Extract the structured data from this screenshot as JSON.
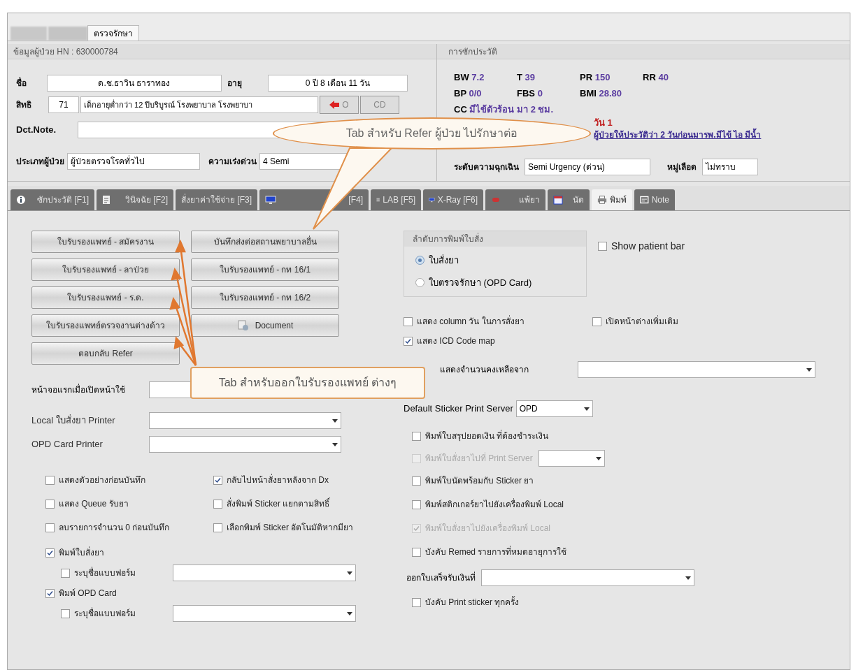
{
  "top_tabs": [
    {
      "label": "ตรวจรักษา",
      "selected": true
    }
  ],
  "patient": {
    "title": "ข้อมูลผู้ป่วย HN : 630000784",
    "name_label": "ชื่อ",
    "name": "ด.ช.ธาวิน ธาราทอง",
    "age_label": "อายุ",
    "age": "0 ปี 8 เดือน 11 วัน",
    "right_label": "สิทธิ",
    "right_code": "71",
    "right_name": "เด็กอายุต่ำกว่า 12 ปีบริบูรณ์ โรงพยาบาล โรงพยาบา",
    "o_button": "O",
    "cd_button": "CD",
    "note_label": "Dct.Note.",
    "type_label": "ประเภทผู้ป่วย",
    "type": "ผู้ป่วยตรวจโรคทั่วไป",
    "urgency_label": "ความเร่งด่วน",
    "urgency": "4 Semi"
  },
  "history": {
    "title": "การซักประวัติ",
    "vitals": [
      [
        {
          "label": "BW",
          "value": "7.2"
        },
        {
          "label": "T",
          "value": "39"
        },
        {
          "label": "PR",
          "value": "150"
        },
        {
          "label": "RR",
          "value": "40"
        }
      ],
      [
        {
          "label": "BP",
          "value": "0/0"
        },
        {
          "label": "FBS",
          "value": "0"
        },
        {
          "label": "BMI",
          "value": "28.80"
        }
      ]
    ],
    "cc_label": "CC",
    "cc": "มีไข้ตัวร้อน มา 2 ชม.",
    "cc_extra": "วัน 1",
    "hpi": "ผู้ป่วยให้ประวัติว่า 2 วันก่อนมารพ.มีไข้ ไอ มีน้ำ",
    "emergency_label": "ระดับความฉุกเฉิน",
    "emergency": "Semi Urgency (ด่วน)",
    "blood_label": "หมู่เลือด",
    "blood": "ไม่ทราบ"
  },
  "tabs": [
    {
      "label": "ซักประวัติ [F1]",
      "selected": false
    },
    {
      "label": "วินิจฉัย [F2]",
      "selected": false
    },
    {
      "label": "สั่งยาค่าใช้จ่าย [F3]",
      "selected": false
    },
    {
      "label": "[F4]",
      "selected": false
    },
    {
      "label": "LAB [F5]",
      "selected": false
    },
    {
      "label": "X-Ray [F6]",
      "selected": false
    },
    {
      "label": "แพ้ยา",
      "selected": false
    },
    {
      "label": "นัด",
      "selected": false
    },
    {
      "label": "พิมพ์",
      "selected": true
    },
    {
      "label": "Note",
      "selected": false
    }
  ],
  "buttons": [
    {
      "kind": "text",
      "label": "ใบรับรองแพทย์ - สมัครงาน"
    },
    {
      "kind": "text",
      "label": "บันทึกส่งต่อสถานพยาบาลอื่น"
    },
    {
      "kind": "text",
      "label": "ใบรับรองแพทย์ - ลาป่วย"
    },
    {
      "kind": "text",
      "label": "ใบรับรองแพทย์ - กท 16/1"
    },
    {
      "kind": "text",
      "label": "ใบรับรองแพทย์ - ร.ด."
    },
    {
      "kind": "text",
      "label": "ใบรับรองแพทย์ - กท 16/2"
    },
    {
      "kind": "text",
      "label": "ใบรับรองแพทย์ตรวจงานต่างด้าว"
    },
    {
      "kind": "icon",
      "label": "Document"
    },
    {
      "kind": "text",
      "label": "ตอบกลับ Refer"
    }
  ],
  "first_screen": {
    "label": "หน้าจอแรกเมื่อเปิดหน้าใช้"
  },
  "printers": [
    {
      "label": "Local ใบสั่งยา Printer"
    },
    {
      "label": "OPD Card Printer"
    }
  ],
  "left_checks": [
    {
      "label": "แสดงตัวอย่างก่อนบันทึก",
      "checked": false
    },
    {
      "label": "กลับไปหน้าสั่งยาหลังจาก Dx",
      "checked": true
    },
    {
      "label": "แสดง Queue รับยา",
      "checked": false
    },
    {
      "label": "สั่งพิมพ์ Sticker แยกตามสิทธิ์",
      "checked": false
    },
    {
      "label": "ลบรายการจำนวน 0 ก่อนบันทึก",
      "checked": false
    },
    {
      "label": "เลือกพิมพ์ Sticker อัตโนมัติหากมียา",
      "checked": false
    }
  ],
  "print_options": [
    {
      "label": "พิมพ์ใบสั่งยา",
      "checked": true,
      "form": {
        "label": "ระบุชื่อแบบฟอร์ม",
        "checked": false
      }
    },
    {
      "label": "พิมพ์ OPD Card",
      "checked": true,
      "form": {
        "label": "ระบุชื่อแบบฟอร์ม",
        "checked": false
      }
    }
  ],
  "print_order": {
    "title": "ลำดับการพิมพ์ใบสั่ง",
    "options": [
      {
        "label": "ใบสั่งยา",
        "selected": true
      },
      {
        "label": "ใบตรวจรักษา (OPD Card)",
        "selected": false
      }
    ]
  },
  "show_patient_bar": {
    "label": "Show patient bar",
    "checked": false
  },
  "display_checks": [
    {
      "label": "แสดง column วัน ในการสั่งยา",
      "checked": false
    },
    {
      "label": "เปิดหน้าต่างเพิ่มเติม",
      "checked": false
    },
    {
      "label": "แสดง ICD Code map",
      "checked": true
    }
  ],
  "stock_from": {
    "label": "แสดงจำนวนคงเหลือจาก"
  },
  "sticker_server": {
    "label": "Default Sticker Print Server",
    "value": "OPD"
  },
  "right_checks": [
    {
      "kind": "check",
      "label": "พิมพ์ใบสรุปยอดเงิน ที่ต้องชำระเงิน",
      "checked": false,
      "disabled": false
    },
    {
      "kind": "check_dropdown",
      "label": "พิมพ์ใบสั่งยาไปที่ Print Server",
      "checked": false,
      "disabled": true
    },
    {
      "kind": "check",
      "label": "พิมพ์ใบนัดพร้อมกับ Sticker ยา",
      "checked": false,
      "disabled": false
    },
    {
      "kind": "check",
      "label": "พิมพ์สติกเกอร์ยาไปยังเครื่องพิมพ์ Local",
      "checked": false,
      "disabled": false
    },
    {
      "kind": "check",
      "label": "พิมพ์ใบสั่งยาไปยังเครื่องพิมพ์ Local",
      "checked": true,
      "disabled": true
    },
    {
      "kind": "check",
      "label": "บังคับ Remed รายการที่หมดอายุการใช้",
      "checked": false,
      "disabled": false
    }
  ],
  "receipt": {
    "label": "ออกใบเสร็จรับเงินที่"
  },
  "force_sticker": {
    "label": "บังคับ Print sticker ทุกครั้ง",
    "checked": false
  },
  "callouts": [
    {
      "kind": "ellipse",
      "text": "Tab สำหรับ Refer ผู้ป่วย ไปรักษาต่อ"
    },
    {
      "kind": "box",
      "text": "Tab สำหรับออกใบรับรองแพทย์ ต่างๆ"
    }
  ]
}
